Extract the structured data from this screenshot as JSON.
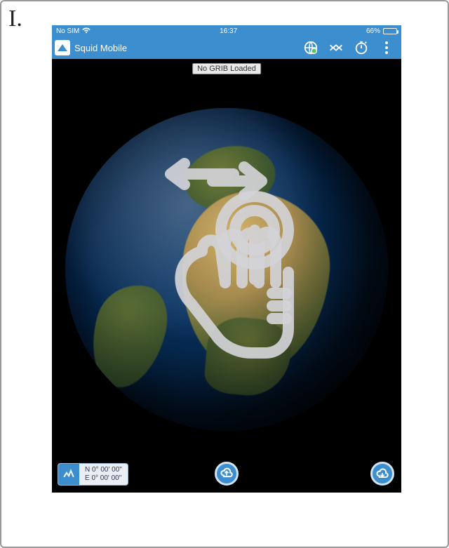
{
  "step_label": "I.",
  "ios_status": {
    "carrier": "No SIM",
    "time": "16:37",
    "battery_pct": "66%"
  },
  "header": {
    "app_title": "Squid Mobile"
  },
  "main": {
    "grib_status": "No GRIB Loaded"
  },
  "bottom": {
    "coords_lat": "N 0° 00' 00\"",
    "coords_lon": "E 0° 00' 00\""
  },
  "colors": {
    "accent": "#3d8ecf"
  }
}
